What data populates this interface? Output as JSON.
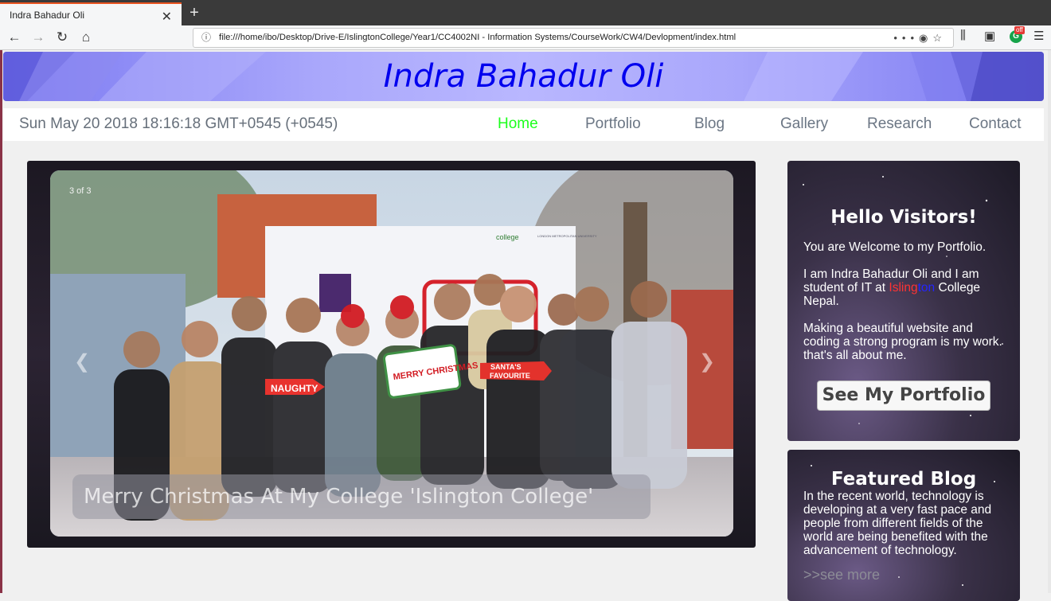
{
  "browser": {
    "tab_title": "Indra Bahadur Oli",
    "tab_close": "✕",
    "new_tab": "+",
    "url": "file:///home/ibo/Desktop/Drive-E/IslingtonCollege/Year1/CC4002NI - Information Systems/CourseWork/CW4/Devlopment/index.html",
    "grammarly_badge": "off"
  },
  "site": {
    "title": "Indra Bahadur Oli",
    "date": "Sun May 20 2018 18:16:18 GMT+0545 (+0545)",
    "menu": [
      "Home",
      "Portfolio",
      "Blog",
      "Gallery",
      "Research",
      "Contact"
    ]
  },
  "slideshow": {
    "counter": "3 of 3",
    "caption": "Merry Christmas At My College 'Islington College'",
    "prev": "❮",
    "next": "❯",
    "photo": {
      "logo_text": "college",
      "logo_sub": "LONDON METROPOLITAN UNIVERSITY",
      "prop_naughty": "NAUGHTY",
      "prop_merry": "MERRY CHRISTMAS",
      "prop_santa_1": "SANTA'S",
      "prop_santa_2": "FAVOURITE"
    }
  },
  "welcome_card": {
    "heading": "Hello Visitors!",
    "line1": "You are Welcome to my Portfolio.",
    "line2_pre": "I am Indra Bahadur Oli and I am student of IT at ",
    "line2_i": "I",
    "line2_sling": "sling",
    "line2_ton": "ton",
    "line2_post": " College Nepal.",
    "line3": "Making a beautiful website and coding a strong program is my work. that's all about me.",
    "button": "See My Portfolio"
  },
  "blog_card": {
    "heading": "Featured Blog",
    "text": "In the recent world, technology is developing at a very fast pace and people from different fields of the world are being benefited with the advancement of technology.",
    "link": ">>see more"
  },
  "colors": {
    "title": "#0000ee",
    "active_menu": "#1cff1c",
    "menu": "#6b7684"
  }
}
